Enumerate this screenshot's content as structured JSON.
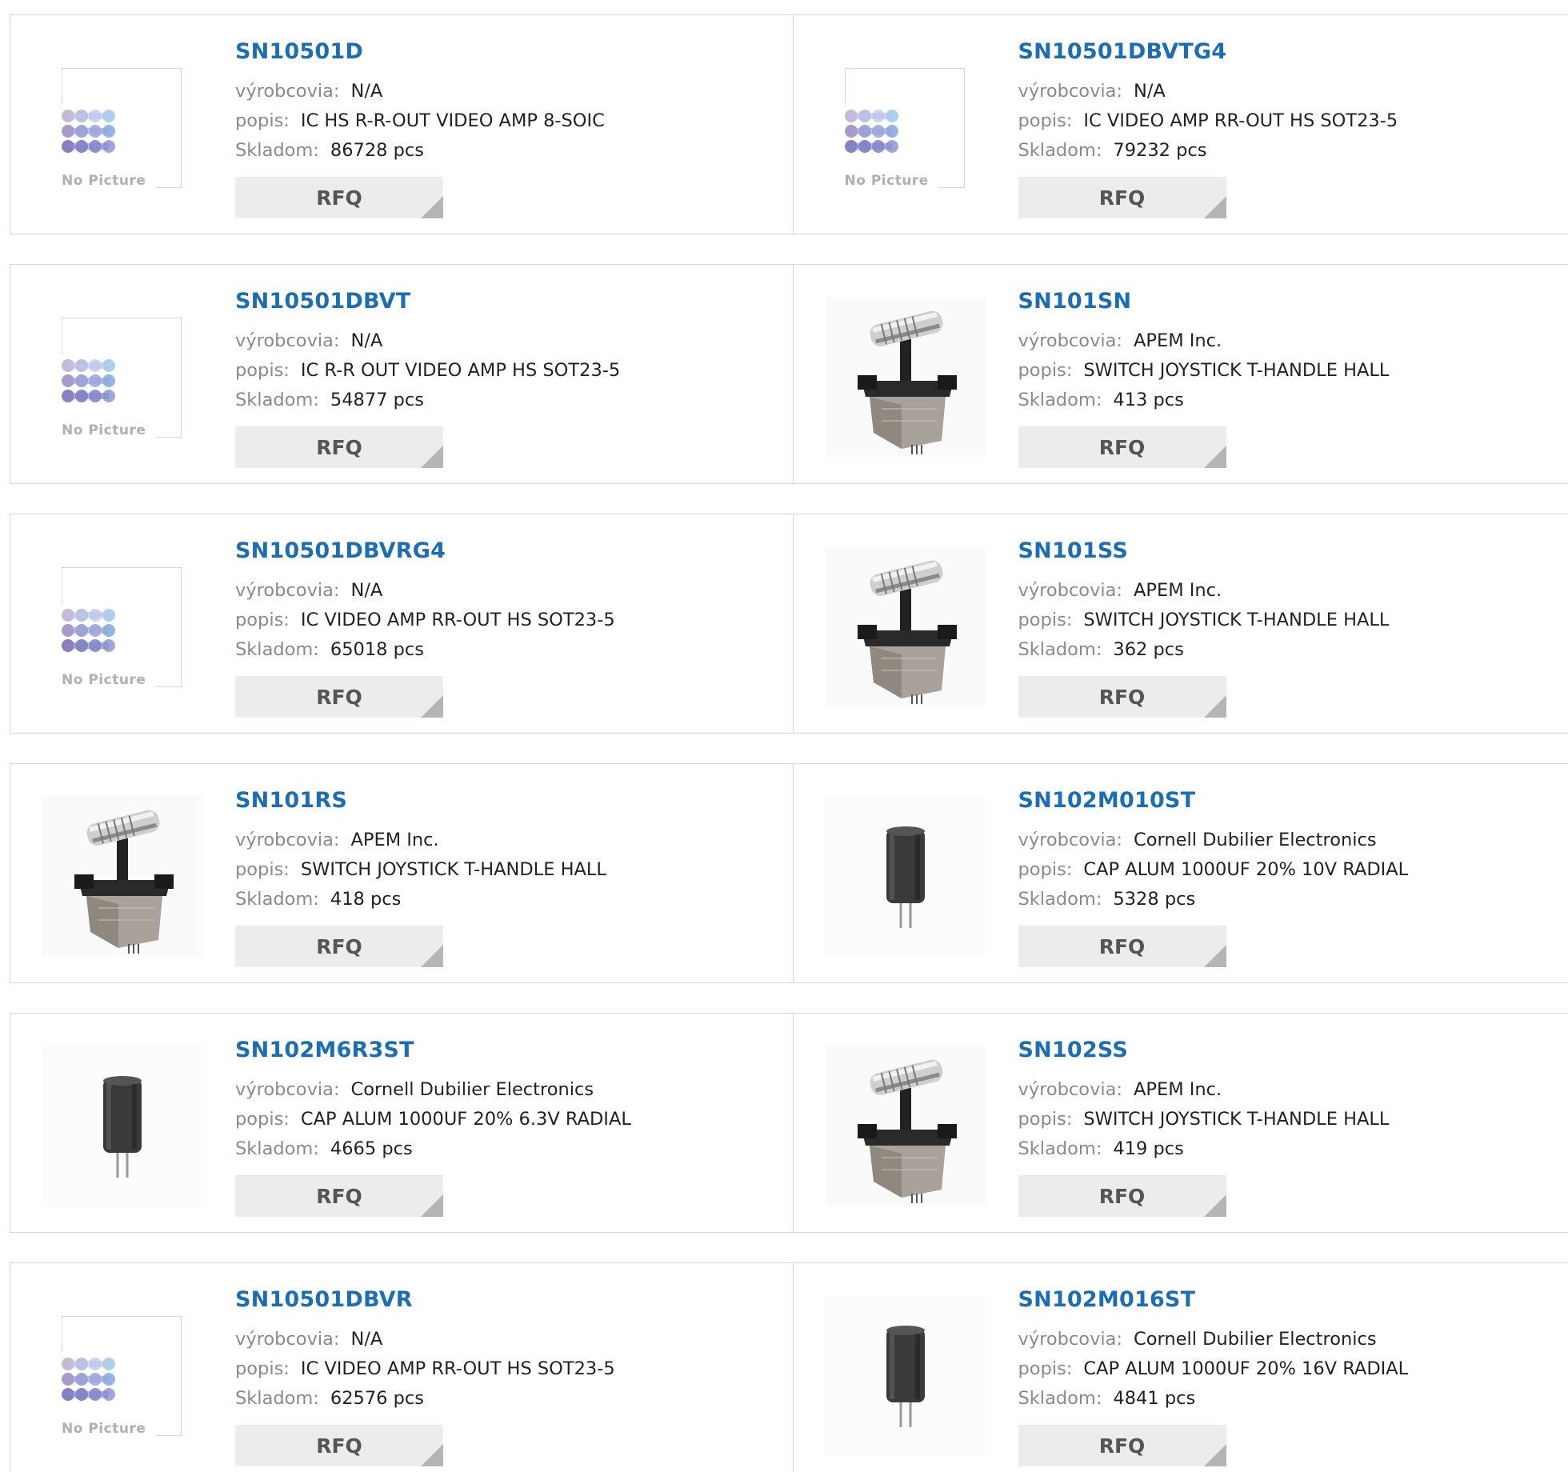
{
  "no_picture_text": "No Picture",
  "labels": {
    "manufacturer": "výrobcovia:",
    "description": "popis:",
    "stock": "Skladom:"
  },
  "rfq_label": "RFQ",
  "colors": {
    "link": "#1a6eb8",
    "key": "#8a8a8a",
    "button_bg": "#ececec"
  },
  "products": [
    {
      "part": "SN10501D",
      "manufacturer": "N/A",
      "description": "IC HS R-R-OUT VIDEO AMP 8-SOIC",
      "stock": "86728 pcs",
      "image": "no-picture-icon"
    },
    {
      "part": "SN10501DBVTG4",
      "manufacturer": "N/A",
      "description": "IC VIDEO AMP RR-OUT HS SOT23-5",
      "stock": "79232 pcs",
      "image": "no-picture-icon"
    },
    {
      "part": "SN10501DBVT",
      "manufacturer": "N/A",
      "description": "IC R-R OUT VIDEO AMP HS SOT23-5",
      "stock": "54877 pcs",
      "image": "no-picture-icon"
    },
    {
      "part": "SN101SN",
      "manufacturer": "APEM Inc.",
      "description": "SWITCH JOYSTICK T-HANDLE HALL",
      "stock": "413 pcs",
      "image": "joystick-icon"
    },
    {
      "part": "SN10501DBVRG4",
      "manufacturer": "N/A",
      "description": "IC VIDEO AMP RR-OUT HS SOT23-5",
      "stock": "65018 pcs",
      "image": "no-picture-icon"
    },
    {
      "part": "SN101SS",
      "manufacturer": "APEM Inc.",
      "description": "SWITCH JOYSTICK T-HANDLE HALL",
      "stock": "362 pcs",
      "image": "joystick-icon"
    },
    {
      "part": "SN101RS",
      "manufacturer": "APEM Inc.",
      "description": "SWITCH JOYSTICK T-HANDLE HALL",
      "stock": "418 pcs",
      "image": "joystick-icon"
    },
    {
      "part": "SN102M010ST",
      "manufacturer": "Cornell Dubilier Electronics",
      "description": "CAP ALUM 1000UF 20% 10V RADIAL",
      "stock": "5328 pcs",
      "image": "capacitor-icon"
    },
    {
      "part": "SN102M6R3ST",
      "manufacturer": "Cornell Dubilier Electronics",
      "description": "CAP ALUM 1000UF 20% 6.3V RADIAL",
      "stock": "4665 pcs",
      "image": "capacitor-icon"
    },
    {
      "part": "SN102SS",
      "manufacturer": "APEM Inc.",
      "description": "SWITCH JOYSTICK T-HANDLE HALL",
      "stock": "419 pcs",
      "image": "joystick-icon"
    },
    {
      "part": "SN10501DBVR",
      "manufacturer": "N/A",
      "description": "IC VIDEO AMP RR-OUT HS SOT23-5",
      "stock": "62576 pcs",
      "image": "no-picture-icon"
    },
    {
      "part": "SN102M016ST",
      "manufacturer": "Cornell Dubilier Electronics",
      "description": "CAP ALUM 1000UF 20% 16V RADIAL",
      "stock": "4841 pcs",
      "image": "capacitor-icon"
    }
  ]
}
